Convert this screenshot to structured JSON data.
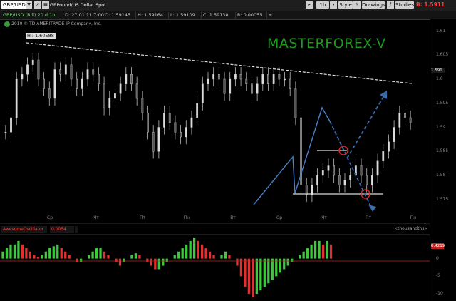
{
  "toolbar": {
    "symbol": "GBP/USD",
    "description": "GBPound/US Dollar Spot",
    "timeframe": "1h",
    "style": "Style",
    "drawings": "Drawings",
    "studies": "Studies",
    "bid_label": "B: 1.5911",
    "bid_color": "#ff3b3b"
  },
  "infobar": {
    "symbol": "GBP/USD (Bill) 20 d 1h",
    "date": "D: 27.01.11 7:00",
    "open": "O: 1.59145",
    "high": "H: 1.59164",
    "low": "L: 1.59109",
    "close": "C: 1.59138",
    "change": "R: 0.00055",
    "extra": "Y:"
  },
  "chart": {
    "copyright": "2010 © TD AMERITRADE IP Company, Inc.",
    "hi_label": "Hi: 1.60588",
    "watermark": "MASTERFOREX-V",
    "watermark_color": "#1d9a1d",
    "price_tag": "1.591"
  },
  "chart_data": [
    {
      "type": "candlestick",
      "title": "GBP/USD 1h",
      "y_ticks": [
        "1.61",
        "1.605",
        "1.6",
        "1.595",
        "1.59",
        "1.585",
        "1.58",
        "1.575"
      ],
      "ylim": [
        1.572,
        1.612
      ],
      "x_ticks": [
        "Ср",
        "Чт",
        "Пт",
        "Пн",
        "Вт",
        "Ср",
        "Чт",
        "Пт",
        "Пн"
      ],
      "close_series": [
        1.589,
        1.592,
        1.6,
        1.601,
        1.603,
        1.604,
        1.6,
        1.598,
        1.596,
        1.602,
        1.601,
        1.603,
        1.6,
        1.598,
        1.6,
        1.602,
        1.601,
        1.599,
        1.594,
        1.596,
        1.597,
        1.599,
        1.601,
        1.599,
        1.596,
        1.593,
        1.589,
        1.585,
        1.59,
        1.593,
        1.591,
        1.589,
        1.588,
        1.59,
        1.592,
        1.595,
        1.599,
        1.6,
        1.601,
        1.6,
        1.597,
        1.6,
        1.601,
        1.6,
        1.599,
        1.597,
        1.599,
        1.601,
        1.599,
        1.601,
        1.6,
        1.6,
        1.598,
        1.592,
        1.578,
        1.576,
        1.578,
        1.58,
        1.581,
        1.582,
        1.58,
        1.578,
        1.579,
        1.58,
        1.582,
        1.58,
        1.578,
        1.58,
        1.583,
        1.585,
        1.587,
        1.59,
        1.593,
        1.592,
        1.591
      ]
    },
    {
      "type": "bar",
      "title": "AwesomeOscillator",
      "value_label": "0.0054",
      "unit_label": "<thousandths>",
      "badge": "0.4219",
      "y_ticks": [
        "0",
        "-5",
        "-10"
      ],
      "ylim": [
        -12,
        7
      ],
      "values": [
        2,
        3,
        4,
        4,
        5,
        4,
        3,
        2,
        1,
        0.5,
        1,
        2,
        3,
        3.5,
        4,
        3,
        2,
        1,
        0,
        -1,
        -1,
        0,
        1,
        2,
        3,
        3,
        2,
        1,
        0,
        -1,
        -2,
        -1,
        0,
        1,
        1.5,
        1,
        0,
        -1,
        -2,
        -3,
        -3,
        -2,
        -1,
        0,
        1,
        2,
        3,
        4,
        5,
        6,
        5,
        4,
        3,
        2,
        1,
        0,
        1,
        2,
        1,
        0,
        -2,
        -5,
        -8,
        -10,
        -11,
        -10,
        -9,
        -8,
        -7,
        -6,
        -5,
        -4,
        -3,
        -2,
        -1,
        0,
        1,
        2,
        3,
        4,
        5,
        5,
        4,
        5,
        4
      ]
    }
  ]
}
